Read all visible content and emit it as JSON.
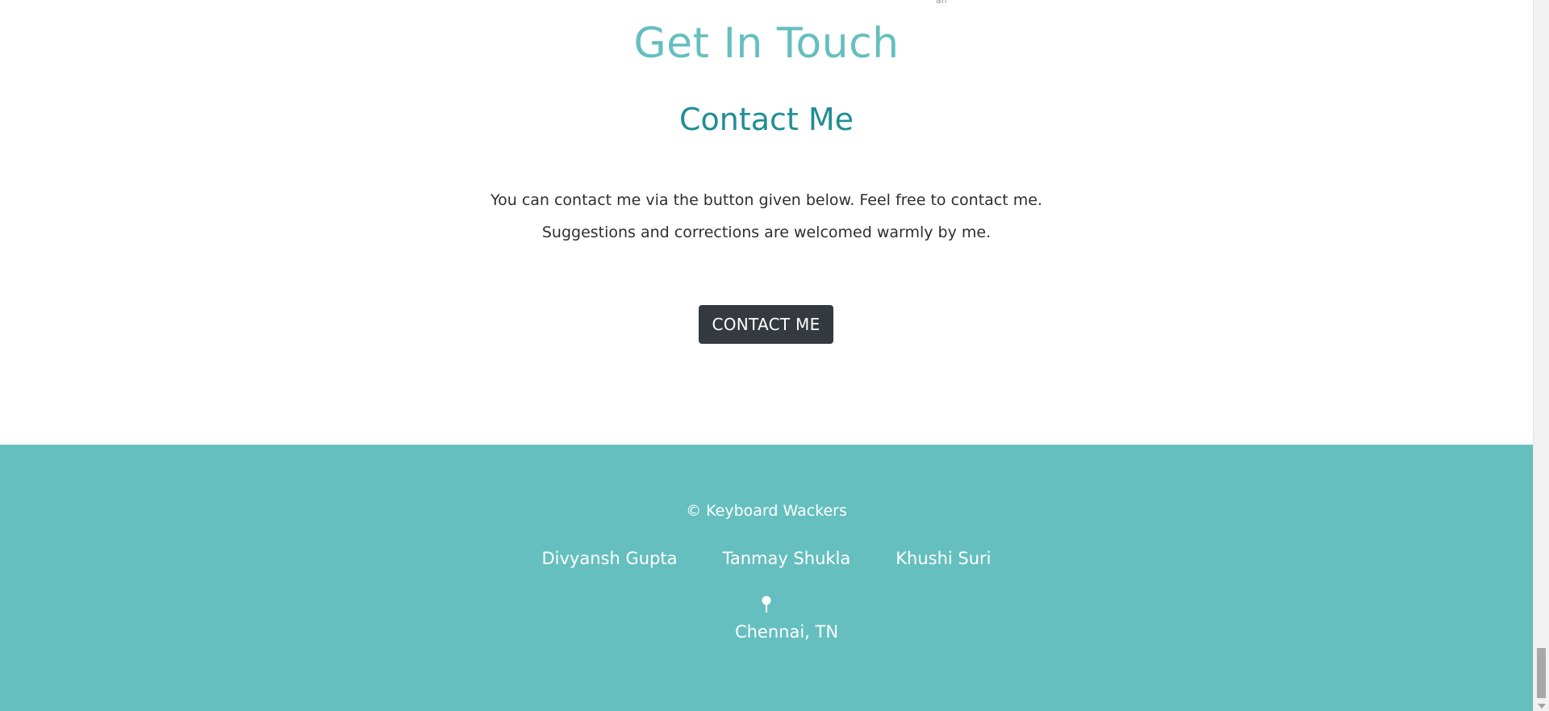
{
  "top_fragment": "aff",
  "contact_section": {
    "title": "Get In Touch",
    "subtitle": "Contact Me",
    "description_lines": [
      "You can contact me via the button given below. Feel free to contact me.",
      "Suggestions and corrections are welcomed warmly by me."
    ],
    "button_label": "CONTACT ME"
  },
  "footer": {
    "copyright": "© Keyboard Wackers",
    "members": [
      {
        "name": "Divyansh Gupta"
      },
      {
        "name": "Tanmay Shukla"
      },
      {
        "name": "Khushi Suri"
      }
    ],
    "location_icon": "map-pin-icon",
    "location": "Chennai, TN"
  },
  "colors": {
    "title_teal": "#66bfbf",
    "subtitle_teal": "#1f8e94",
    "footer_bg": "#66bfbf",
    "button_bg": "#343a40"
  }
}
